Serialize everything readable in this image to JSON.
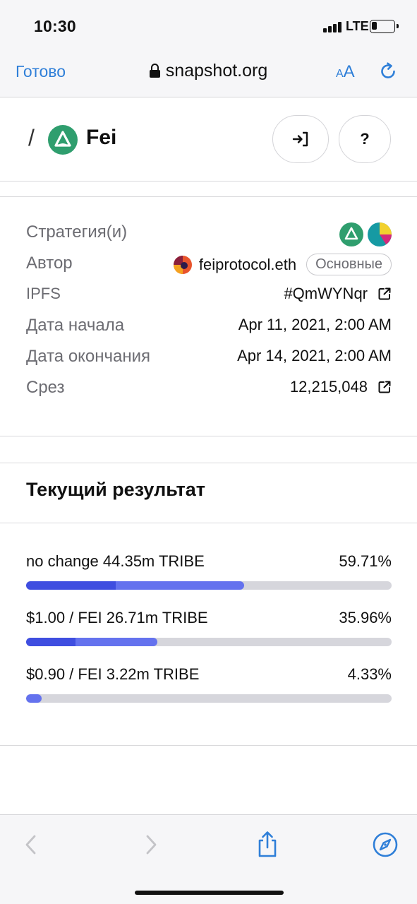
{
  "status_bar": {
    "time": "10:30",
    "network": "LTE",
    "battery_level": 0.15
  },
  "browser": {
    "done_label": "Готово",
    "url": "snapshot.org",
    "text_size_small": "A",
    "text_size_big": "A"
  },
  "space": {
    "separator": "/",
    "name": "Fei",
    "help_label": "?"
  },
  "info": {
    "strategy_label": "Стратегия(и)",
    "author_label": "Автор",
    "author_value": "feiprotocol.eth",
    "author_badge": "Основные",
    "ipfs_label": "IPFS",
    "ipfs_value": "#QmWYNqr",
    "start_label": "Дата начала",
    "start_value": "Apr 11, 2021, 2:00 AM",
    "end_label": "Дата окончания",
    "end_value": "Apr 14, 2021, 2:00 AM",
    "snapshot_label": "Срез",
    "snapshot_value": "12,215,048"
  },
  "results": {
    "title": "Текущий результат",
    "items": [
      {
        "label": "no change 44.35m TRIBE",
        "percent": "59.71%",
        "fill": 0.5971,
        "dark_fill": 0.245
      },
      {
        "label": "$1.00 / FEI 26.71m TRIBE",
        "percent": "35.96%",
        "fill": 0.3596,
        "dark_fill": 0.135
      },
      {
        "label": "$0.90 / FEI 3.22m TRIBE",
        "percent": "4.33%",
        "fill": 0.0433,
        "dark_fill": 0.0
      }
    ]
  },
  "colors": {
    "accent": "#2f7fd8",
    "bar_light": "#6472ee",
    "bar_dark": "#3f4ee0",
    "track": "#d6d6dc",
    "fei_green": "#2f9e6e"
  }
}
